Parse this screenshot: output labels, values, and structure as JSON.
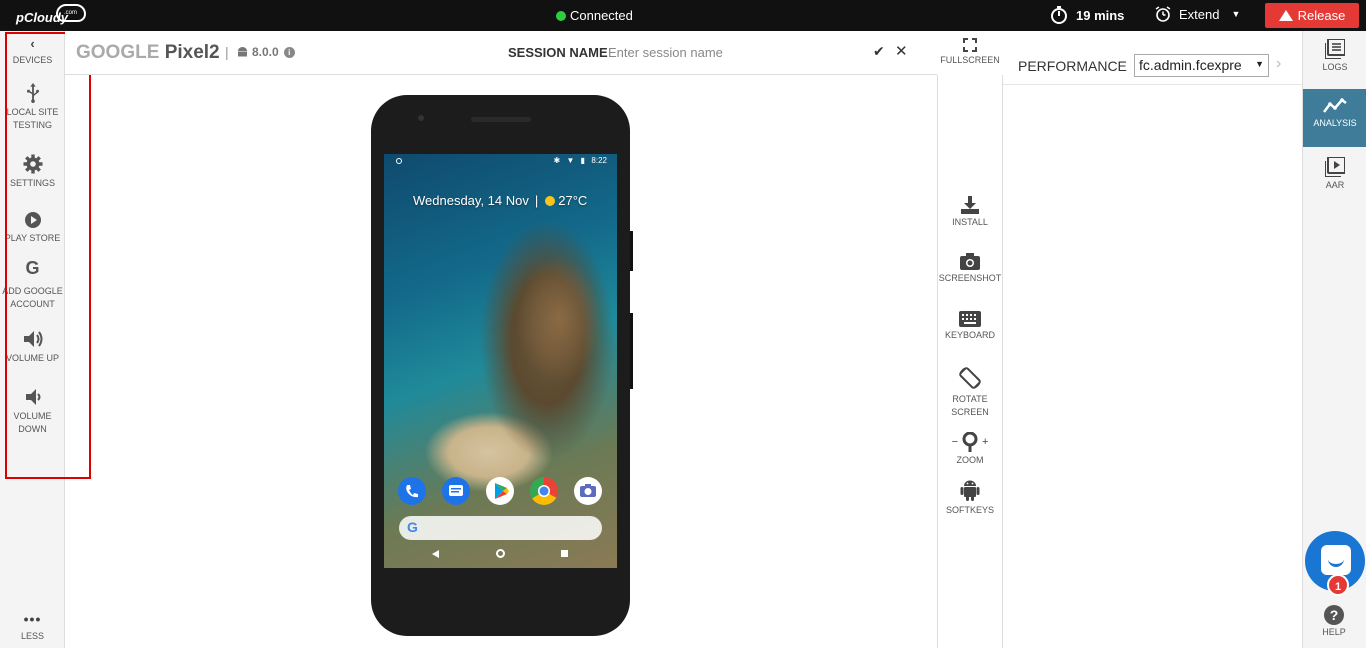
{
  "topbar": {
    "logo": "pCloudy",
    "logo_suffix": ".com",
    "status": "Connected",
    "timer": "19 mins",
    "extend_label": "Extend",
    "release_label": "Release"
  },
  "leftbar": {
    "devices": "DEVICES",
    "local_site_testing_1": "LOCAL SITE",
    "local_site_testing_2": "TESTING",
    "settings": "SETTINGS",
    "play_store": "PLAY STORE",
    "add_google_1": "ADD GOOGLE",
    "add_google_2": "ACCOUNT",
    "volume_up": "VOLUME UP",
    "volume_down_1": "VOLUME",
    "volume_down_2": "DOWN",
    "less": "LESS"
  },
  "header": {
    "brand": "GOOGLE",
    "model": "Pixel2",
    "separator": "|",
    "android_version": "8.0.0",
    "session_label": "SESSION NAME",
    "session_placeholder": "Enter session name"
  },
  "tools": {
    "fullscreen": "FULLSCREEN",
    "install": "INSTALL",
    "screenshot": "SCREENSHOT",
    "keyboard": "KEYBOARD",
    "rotate_1": "ROTATE",
    "rotate_2": "SCREEN",
    "zoom": "ZOOM",
    "softkeys": "SOFTKEYS"
  },
  "phone": {
    "time": "8:22",
    "date": "Wednesday, 14 Nov",
    "temperature": "27°C"
  },
  "performance": {
    "title": "PERFORMANCE",
    "selected_app": "fc.admin.fcexpre"
  },
  "rightbar": {
    "logs": "LOGS",
    "analysis": "ANALYSIS",
    "aar": "AAR",
    "help": "HELP",
    "chat_badge": "1"
  },
  "colors": {
    "topbar": "#111111",
    "connected": "#2ecc40",
    "release": "#e53935",
    "analysis_active": "#3e7c99",
    "chat": "#1976d2"
  }
}
